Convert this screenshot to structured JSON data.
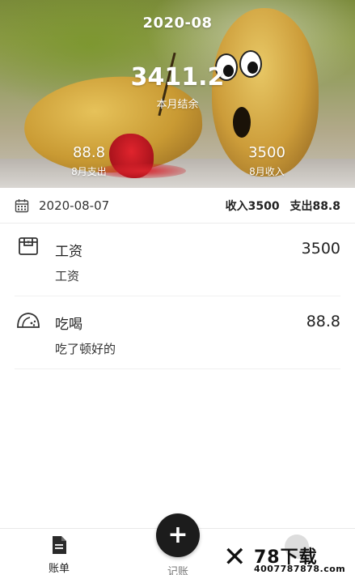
{
  "header": {
    "month": "2020-08",
    "balance": "3411.2",
    "balance_label": "本月结余",
    "expense_value": "88.8",
    "expense_label": "8月支出",
    "income_value": "3500",
    "income_label": "8月收入"
  },
  "day": {
    "date": "2020-08-07",
    "income_summary": "收入3500",
    "expense_summary": "支出88.8"
  },
  "records": [
    {
      "category": "工资",
      "amount": "3500",
      "note": "工资",
      "icon": "wallet-icon"
    },
    {
      "category": "吃喝",
      "amount": "88.8",
      "note": "吃了顿好的",
      "icon": "taco-icon"
    }
  ],
  "nav": {
    "bill_label": "账单",
    "record_label": "记账",
    "add_symbol": "+"
  },
  "watermark": {
    "brand": "78下载",
    "phone": "4007787878.com"
  }
}
